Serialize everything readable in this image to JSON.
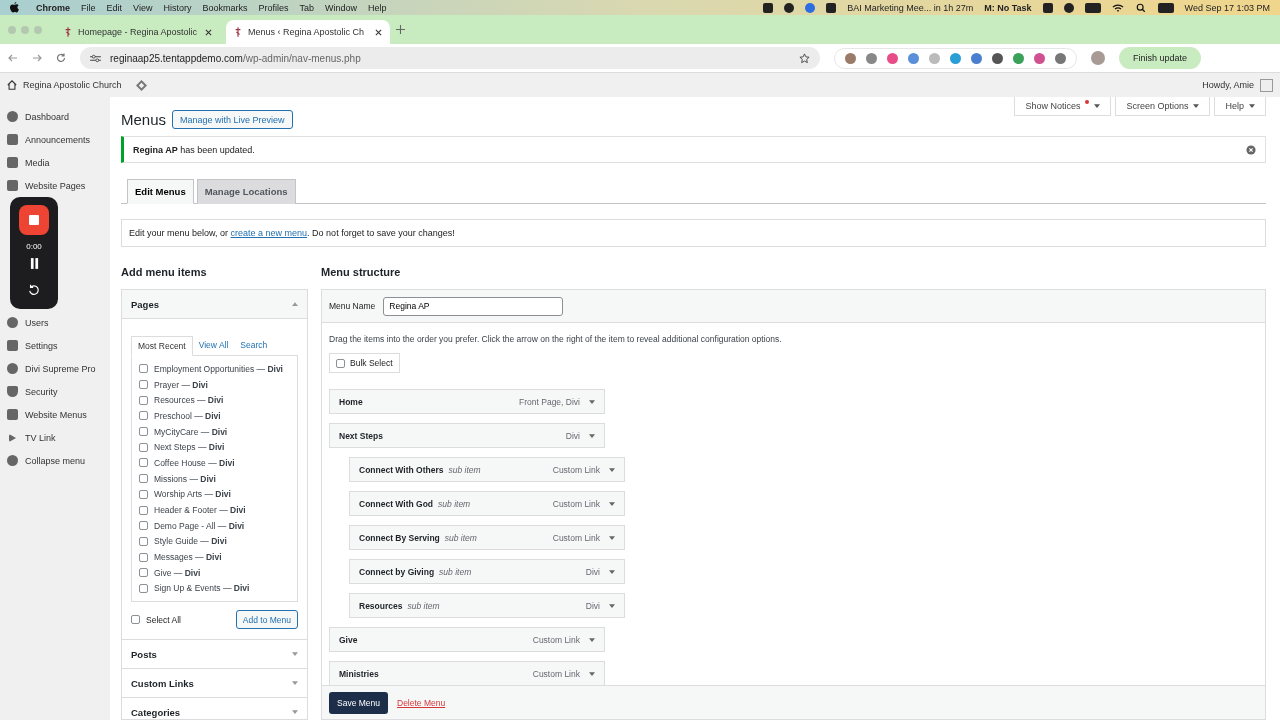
{
  "mac_menu_bar": {
    "app": "Chrome",
    "menus": [
      "File",
      "Edit",
      "View",
      "History",
      "Bookmarks",
      "Profiles",
      "Tab",
      "Window",
      "Help"
    ],
    "meeting": "BAI Marketing Mee... in 1h 27m",
    "task": "M: No Task",
    "clock": "Wed Sep 17  1:03 PM"
  },
  "browser": {
    "tabs": [
      {
        "title": "Homepage - Regina Apostolic",
        "selected": false
      },
      {
        "title": "Menus ‹ Regina Apostolic Ch",
        "selected": true
      }
    ],
    "url_host": "reginaap25.tentappdemo.com",
    "url_path": "/wp-admin/nav-menus.php",
    "update_button": "Finish update"
  },
  "admin_bar": {
    "site": "Regina Apostolic Church",
    "greeting": "Howdy, Amie"
  },
  "sidebar": {
    "items_top": [
      {
        "label": "Dashboard"
      },
      {
        "label": "Announcements"
      },
      {
        "label": "Media"
      },
      {
        "label": "Website Pages"
      }
    ],
    "items_bottom": [
      {
        "label": "Users"
      },
      {
        "label": "Settings"
      },
      {
        "label": "Divi Supreme Pro"
      },
      {
        "label": "Security"
      },
      {
        "label": "Website Menus"
      },
      {
        "label": "TV Link"
      },
      {
        "label": "Collapse menu"
      }
    ]
  },
  "recorder": {
    "time": "0:00"
  },
  "screen_meta": [
    {
      "label": "Show Notices",
      "alert": true
    },
    {
      "label": "Screen Options",
      "alert": false
    },
    {
      "label": "Help",
      "alert": false
    }
  ],
  "page": {
    "title": "Menus",
    "live_preview_button": "Manage with Live Preview",
    "notice": "**Regina AP** has been updated.",
    "tabs": [
      {
        "label": "Edit Menus",
        "selected": true
      },
      {
        "label": "Manage Locations",
        "selected": false
      }
    ],
    "info_before": "Edit your menu below, or ",
    "info_link": "create a new menu",
    "info_after": ". Do not forget to save your changes!"
  },
  "add_items": {
    "heading": "Add menu items",
    "sections": [
      {
        "title": "Pages",
        "expanded": true
      },
      {
        "title": "Posts",
        "expanded": false
      },
      {
        "title": "Custom Links",
        "expanded": false
      },
      {
        "title": "Categories",
        "expanded": false
      }
    ],
    "page_tabs": [
      {
        "label": "Most Recent",
        "selected": true
      },
      {
        "label": "View All",
        "selected": false
      },
      {
        "label": "Search",
        "selected": false
      }
    ],
    "pages": [
      {
        "label": "Employment Opportunities — **Divi**",
        "checked": false
      },
      {
        "label": "Prayer — **Divi**",
        "checked": false
      },
      {
        "label": "Resources — **Divi**",
        "checked": false
      },
      {
        "label": "Preschool — **Divi**",
        "checked": false
      },
      {
        "label": "MyCityCare — **Divi**",
        "checked": false
      },
      {
        "label": "Next Steps — **Divi**",
        "checked": false
      },
      {
        "label": "Coffee House — **Divi**",
        "checked": false
      },
      {
        "label": "Missions — **Divi**",
        "checked": false
      },
      {
        "label": "Worship Arts — **Divi**",
        "checked": false
      },
      {
        "label": "Header & Footer — **Divi**",
        "checked": false
      },
      {
        "label": "Demo Page - All — **Divi**",
        "checked": false
      },
      {
        "label": "Style Guide — **Divi**",
        "checked": false
      },
      {
        "label": "Messages — **Divi**",
        "checked": false
      },
      {
        "label": "Give — **Divi**",
        "checked": false
      },
      {
        "label": "Sign Up & Events — **Divi**",
        "checked": false
      }
    ],
    "select_all": {
      "label": "Select All",
      "checked": false
    },
    "add_button": "Add to Menu"
  },
  "menu_structure": {
    "heading": "Menu structure",
    "name_label": "Menu Name",
    "name_value": "Regina AP",
    "instructions": "Drag the items into the order you prefer. Click the arrow on the right of the item to reveal additional configuration options.",
    "bulk_select": {
      "label": "Bulk Select",
      "checked": false
    },
    "items": [
      {
        "title": "Home",
        "type": "Front Page, Divi"
      },
      {
        "title": "Next Steps",
        "type": "Divi",
        "children": [
          {
            "title": "Connect With Others",
            "note": "sub item",
            "type": "Custom Link"
          },
          {
            "title": "Connect With God",
            "note": "sub item",
            "type": "Custom Link"
          },
          {
            "title": "Connect By Serving",
            "note": "sub item",
            "type": "Custom Link"
          },
          {
            "title": "Connect by Giving",
            "note": "sub item",
            "type": "Divi"
          },
          {
            "title": "Resources",
            "note": "sub item",
            "type": "Divi"
          }
        ]
      },
      {
        "title": "Give",
        "type": "Custom Link"
      },
      {
        "title": "Ministries",
        "type": "Custom Link"
      }
    ],
    "save_button": "Save Menu",
    "delete_link": "Delete Menu"
  }
}
